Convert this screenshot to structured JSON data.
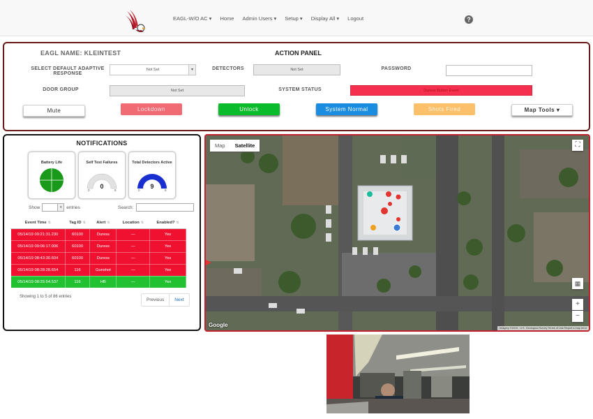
{
  "nav": {
    "items": [
      "EAGL-W/O AC ▾",
      "Home",
      "Admin Users ▾",
      "Setup ▾",
      "Display All ▾",
      "Logout"
    ],
    "help_icon": "question-circle-icon"
  },
  "action_panel": {
    "eagl_name": "EAGL NAME: KLEINTEST",
    "title": "ACTION PANEL",
    "select_default_label": "SELECT DEFAULT ADAPTIVE RESPONSE",
    "select_default_value": "Not Set",
    "detectors_label": "DETECTORS",
    "detectors_value": "Not Set",
    "password_label": "PASSWORD",
    "password_value": "",
    "door_group_label": "DOOR GROUP",
    "door_group_value": "Not Set",
    "system_status_label": "SYSTEM STATUS",
    "system_status_value": "Duress Button Event",
    "buttons": {
      "mute": "Mute",
      "lockdown": "Lockdown",
      "unlock": "Unlock",
      "system_normal": "System Normal",
      "shots_fired": "Shots Fired",
      "map_tools": "Map Tools ▾"
    }
  },
  "notifications": {
    "title": "NOTIFICATIONS",
    "gauges": [
      {
        "label": "Battery Life",
        "type": "pie",
        "color": "#1a9a1a"
      },
      {
        "label": "Self Test Failures",
        "value": "0",
        "min": "0",
        "max": "9",
        "fraction": 0.0,
        "color": "#e0e0e0"
      },
      {
        "label": "Total Detectors Active",
        "value": "9",
        "min": "0",
        "max": "9",
        "fraction": 1.0,
        "color": "#1a2fd0"
      }
    ],
    "show_label": "Show",
    "entries_label": "entries",
    "search_label": "Search:",
    "columns": [
      "Event Time",
      "Tag ID",
      "Alert",
      "Location",
      "Enabled?"
    ],
    "rows": [
      {
        "time": "05/14/19 09:21:31.230",
        "tag": "60100",
        "alert": "Duress",
        "location": "—",
        "enabled": "Yes",
        "status": "red"
      },
      {
        "time": "05/14/19 09:06:17.006",
        "tag": "60100",
        "alert": "Duress",
        "location": "—",
        "enabled": "Yes",
        "status": "red"
      },
      {
        "time": "05/14/19 08:43:30.604",
        "tag": "60100",
        "alert": "Duress",
        "location": "—",
        "enabled": "Yes",
        "status": "red"
      },
      {
        "time": "05/14/19 08:28:28.654",
        "tag": "116",
        "alert": "Gunshot",
        "location": "—",
        "enabled": "Yes",
        "status": "red"
      },
      {
        "time": "05/14/19 08:25:54.537",
        "tag": "116",
        "alert": "HB",
        "location": "—",
        "enabled": "Yes",
        "status": "green"
      }
    ],
    "showing_text": "Showing 1 to 5 of 86 entries",
    "previous": "Previous",
    "next": "Next"
  },
  "map": {
    "tab_map": "Map",
    "tab_satellite": "Satellite",
    "google": "Google",
    "attribution": "Imagery ©2019 , U.S. Geological Survey   Terms of Use   Report a map error",
    "zoom_in": "+",
    "zoom_out": "−"
  }
}
